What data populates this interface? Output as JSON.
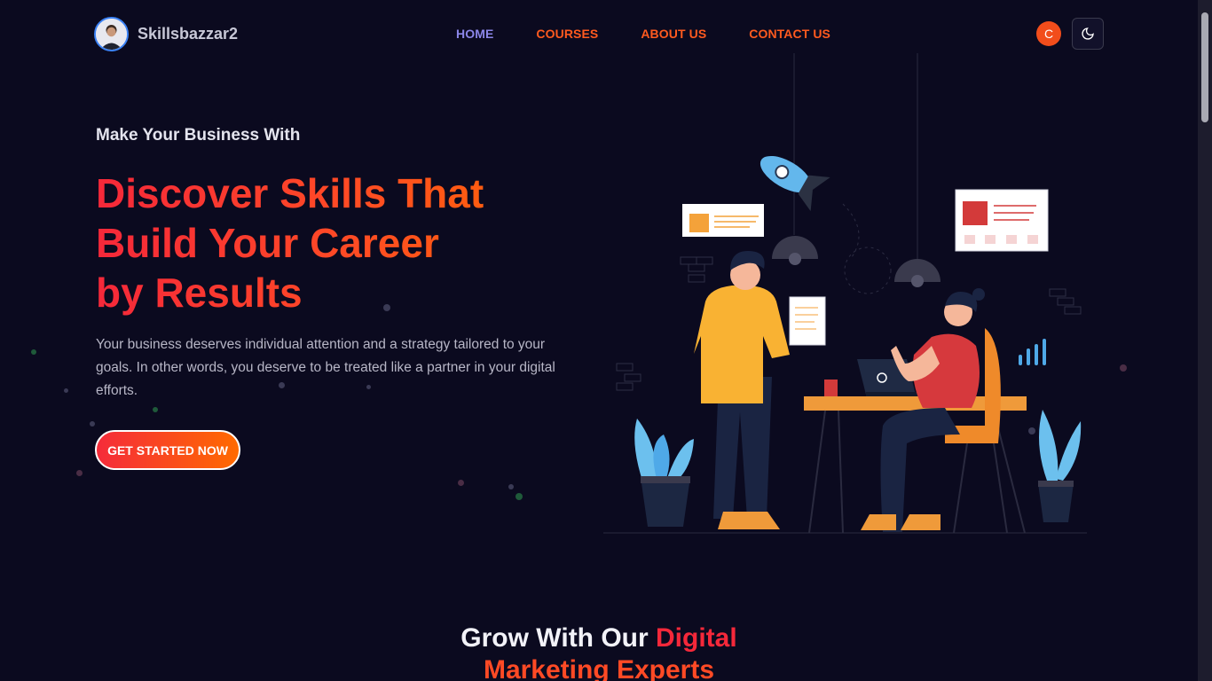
{
  "header": {
    "brand_name": "Skillsbazzar2",
    "nav": [
      {
        "label": "HOME",
        "active": true
      },
      {
        "label": "COURSES",
        "active": false
      },
      {
        "label": "ABOUT US",
        "active": false
      },
      {
        "label": "CONTACT US",
        "active": false
      }
    ],
    "user_initial": "C",
    "theme_icon": "moon-icon"
  },
  "hero": {
    "eyebrow": "Make Your Business With",
    "headline_lines": [
      "Discover Skills That",
      "Build Your Career",
      "by Results"
    ],
    "description": "Your business deserves individual attention and a strategy tailored to your goals. In other words, you deserve to be treated like a partner in your digital efforts.",
    "cta_label": "GET STARTED NOW"
  },
  "section": {
    "title_part1": "Grow With Our ",
    "title_accent1": "Digital",
    "title_accent2": "Marketing Experts"
  },
  "colors": {
    "background": "#0b0a1f",
    "accent_red": "#f5283a",
    "accent_orange": "#ff6a00",
    "nav_active": "#8b86e8"
  }
}
